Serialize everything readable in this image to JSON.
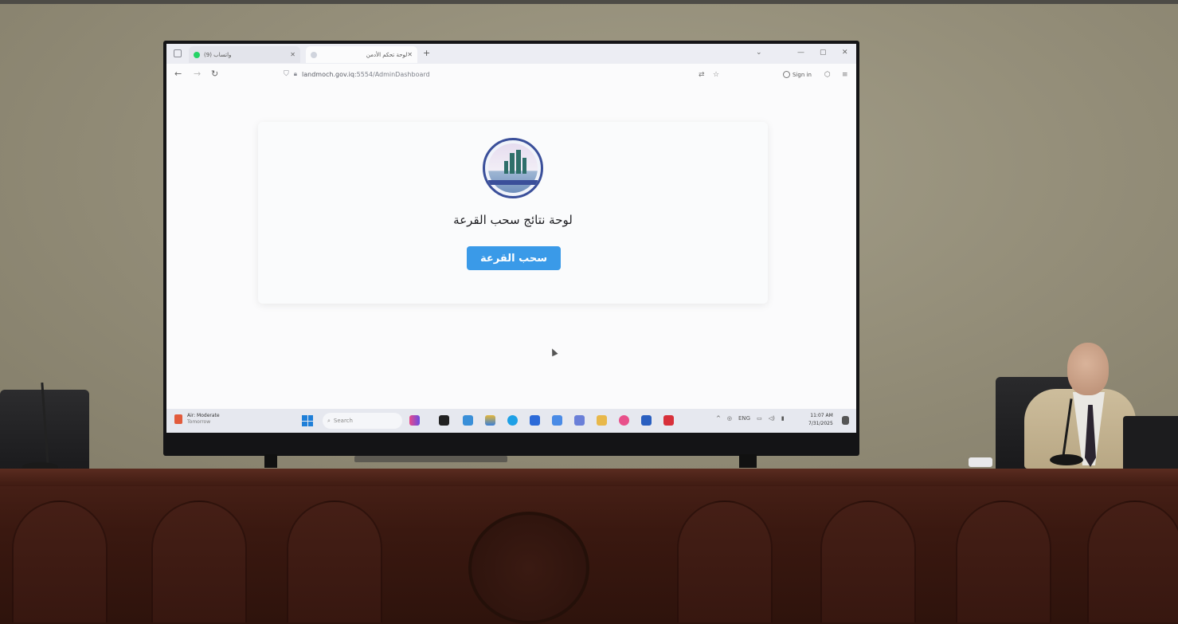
{
  "browser": {
    "tabs": [
      {
        "title": "واتساب (9)",
        "active": false,
        "favicon_color": "#25d366"
      },
      {
        "title": "لوحة تحكم الأدمن",
        "active": true,
        "favicon_color": "#d0d4dd"
      }
    ],
    "new_tab_symbol": "+",
    "window_controls": {
      "minimize": "—",
      "maximize": "▢",
      "close": "✕"
    },
    "address": {
      "host": "landmoch.gov.iq",
      "path": ":5554/AdminDashboard"
    },
    "sign_in_label": "Sign in"
  },
  "page": {
    "title": "لوحة نتائج سحب القرعة",
    "draw_button_label": "سحب القرعة",
    "accent_color": "#3a9ae8"
  },
  "taskbar": {
    "weather_title": "Air: Moderate",
    "weather_subtitle": "Tomorrow",
    "search_placeholder": "Search",
    "language": "ENG",
    "time": "11:07 AM",
    "date": "7/31/2025"
  }
}
